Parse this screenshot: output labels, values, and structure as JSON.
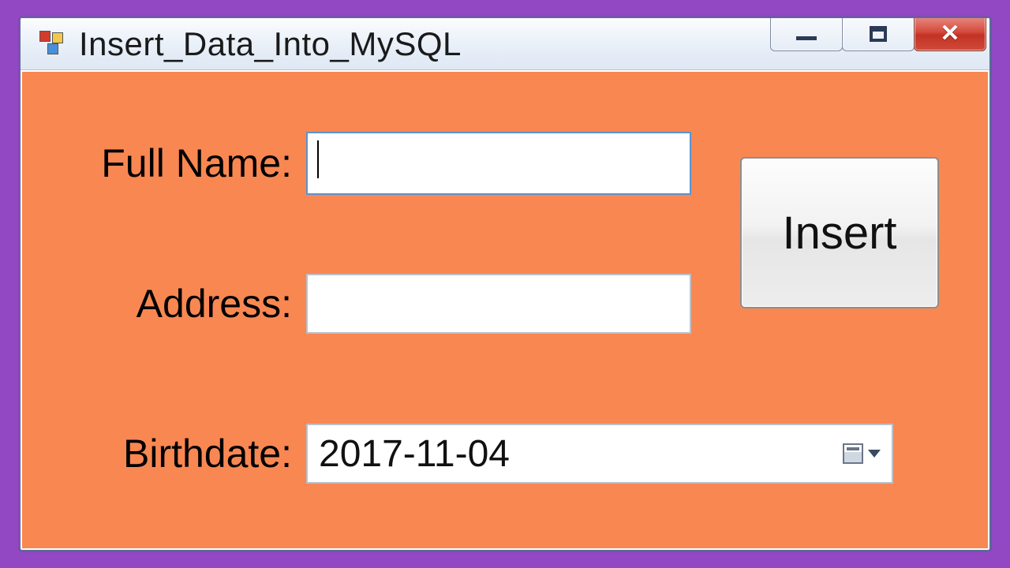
{
  "window": {
    "title": "Insert_Data_Into_MySQL"
  },
  "form": {
    "full_name_label": "Full Name:",
    "full_name_value": "",
    "address_label": "Address:",
    "address_value": "",
    "birthdate_label": "Birthdate:",
    "birthdate_value": "2017-11-04"
  },
  "buttons": {
    "insert_label": "Insert"
  }
}
